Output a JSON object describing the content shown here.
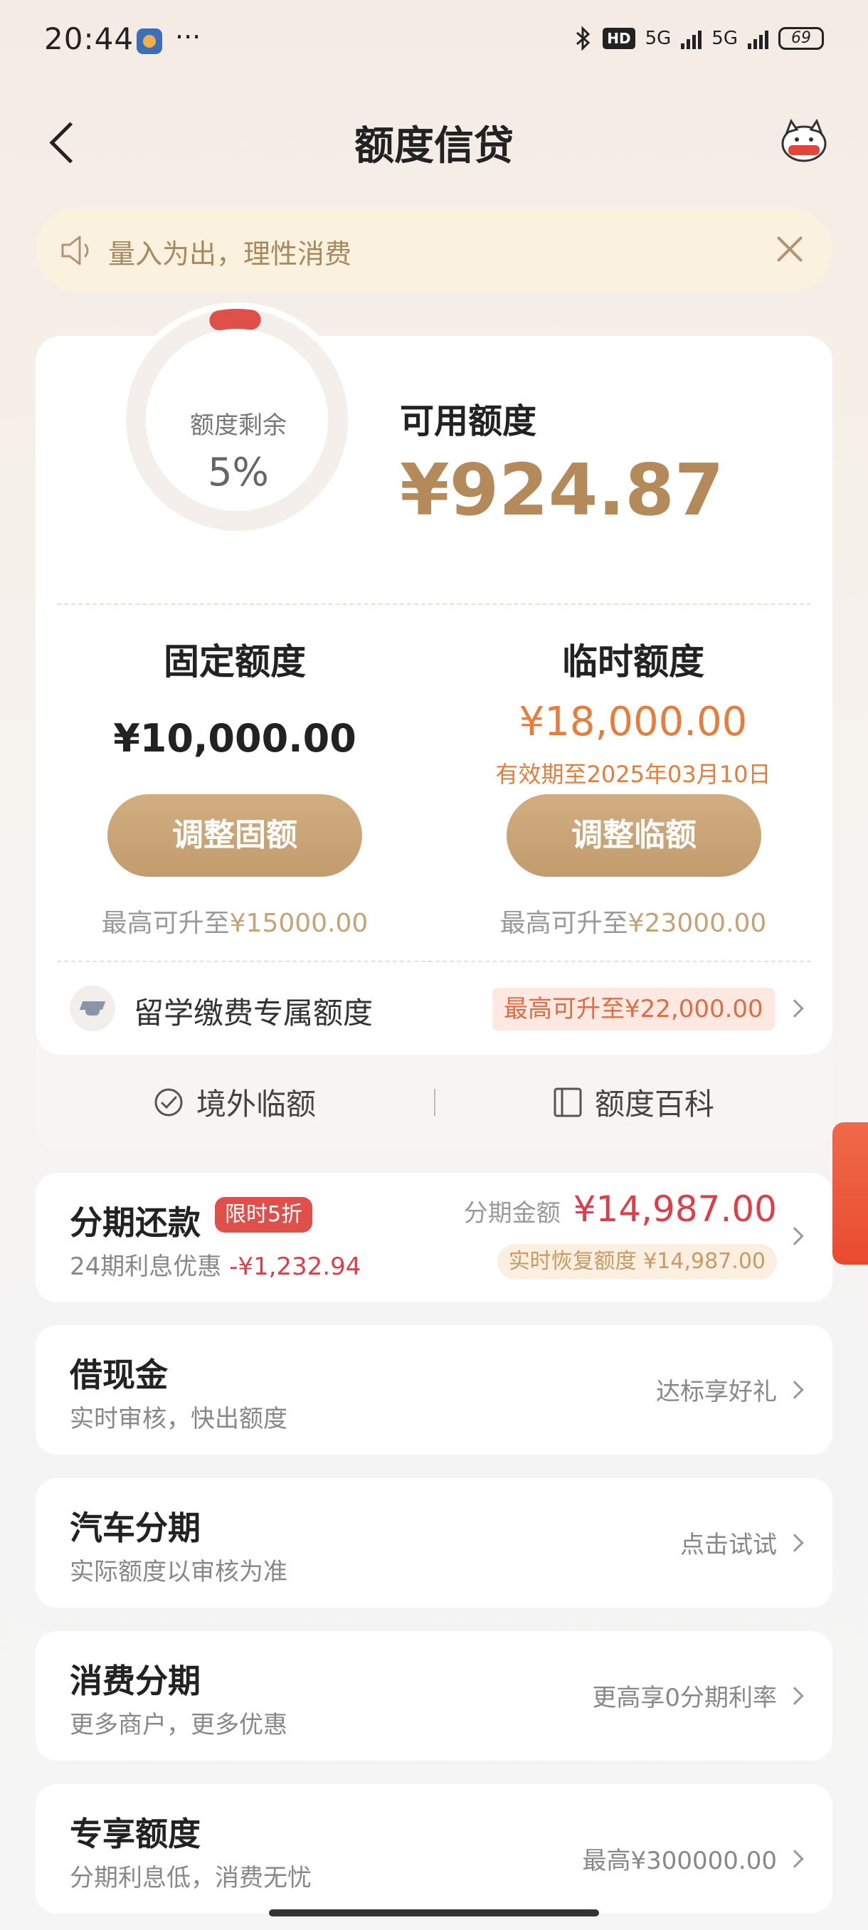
{
  "status_bar": {
    "time": "20:44",
    "dots": "···",
    "hd": "HD",
    "net1": "5G",
    "net2": "5G",
    "battery": "69"
  },
  "header": {
    "title": "额度信贷"
  },
  "notice": {
    "text": "量入为出，理性消费"
  },
  "quota": {
    "remaining_label": "额度剩余",
    "remaining_percent": "5%",
    "remaining_fraction": 0.05,
    "available_label": "可用额度",
    "available_amount": "¥924.87",
    "fixed": {
      "title": "固定额度",
      "amount": "¥10,000.00",
      "button": "调整固额",
      "max_prefix": "最高可升至",
      "max_amount": "¥15000.00"
    },
    "temporary": {
      "title": "临时额度",
      "amount": "¥18,000.00",
      "expiry": "有效期至2025年03月10日",
      "button": "调整临额",
      "max_prefix": "最高可升至",
      "max_amount": "¥23000.00"
    },
    "study": {
      "label": "留学缴费专属额度",
      "tag": "最高可升至¥22,000.00"
    },
    "links": {
      "overseas": "境外临额",
      "wiki": "额度百科"
    }
  },
  "installment": {
    "title": "分期还款",
    "badge": "限时5折",
    "sub_prefix": "24期利息优惠",
    "sub_discount": "-¥1,232.94",
    "amount_label": "分期金额",
    "amount": "¥14,987.00",
    "recover_tag": "实时恢复额度 ¥14,987.00"
  },
  "cards": [
    {
      "title": "借现金",
      "subtitle": "实时审核，快出额度",
      "right": "达标享好礼"
    },
    {
      "title": "汽车分期",
      "subtitle": "实际额度以审核为准",
      "right": "点击试试"
    },
    {
      "title": "消费分期",
      "subtitle": "更多商户，更多优惠",
      "right": "更高享0分期利率"
    },
    {
      "title": "专享额度",
      "subtitle": "分期利息低，消费无忧",
      "right": "最高¥300000.00"
    }
  ],
  "colors": {
    "accent_gold": "#c29c6d",
    "temp_orange": "#e57d3d",
    "alert_red": "#d9404a"
  }
}
